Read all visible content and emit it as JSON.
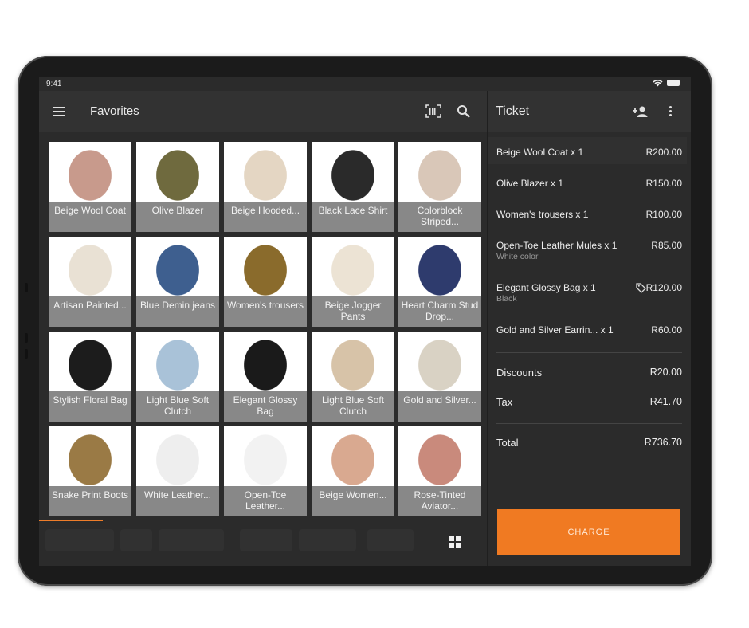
{
  "status": {
    "time": "9:41"
  },
  "header": {
    "title": "Favorites",
    "barcode_icon": "barcode-scan-icon",
    "search_icon": "search-icon",
    "menu_icon": "hamburger-menu-icon"
  },
  "products": [
    {
      "label": "Beige Wool Coat",
      "color": "#c89a8c"
    },
    {
      "label": "Olive Blazer",
      "color": "#6f6a3e"
    },
    {
      "label": "Beige Hooded...",
      "color": "#e4d6c3"
    },
    {
      "label": "Black Lace Shirt",
      "color": "#2a2a2a"
    },
    {
      "label": "Colorblock Striped...",
      "color": "#d9c7b8"
    },
    {
      "label": "Artisan Painted...",
      "color": "#e9e1d4"
    },
    {
      "label": "Blue Demin jeans",
      "color": "#3e5f8f"
    },
    {
      "label": "Women's trousers",
      "color": "#8a6b2c"
    },
    {
      "label": "Beige Jogger Pants",
      "color": "#ece3d4"
    },
    {
      "label": "Heart Charm Stud Drop...",
      "color": "#2e3b6d"
    },
    {
      "label": "Stylish Floral Bag",
      "color": "#1c1c1c"
    },
    {
      "label": "Light Blue Soft Clutch",
      "color": "#a9c2d8"
    },
    {
      "label": "Elegant Glossy Bag",
      "color": "#1a1a1a"
    },
    {
      "label": "Light Blue Soft Clutch",
      "color": "#d7c3a8"
    },
    {
      "label": "Gold and Silver...",
      "color": "#d9d2c4"
    },
    {
      "label": "Snake Print Boots",
      "color": "#9a7a45"
    },
    {
      "label": "White Leather...",
      "color": "#eeeeee"
    },
    {
      "label": "Open-Toe Leather...",
      "color": "#f2f2f2"
    },
    {
      "label": "Beige Women...",
      "color": "#d9a990"
    },
    {
      "label": "Rose-Tinted Aviator...",
      "color": "#c98a7c"
    }
  ],
  "ticket": {
    "title": "Ticket",
    "items": [
      {
        "name": "Beige Wool Coat x 1",
        "price": "R200.00",
        "sub": ""
      },
      {
        "name": "Olive Blazer x 1",
        "price": "R150.00",
        "sub": ""
      },
      {
        "name": "Women's trousers x 1",
        "price": "R100.00",
        "sub": ""
      },
      {
        "name": "Open-Toe Leather Mules x 1",
        "price": "R85.00",
        "sub": "White color"
      },
      {
        "name": "Elegant Glossy Bag x 1",
        "price": "R120.00",
        "sub": "Black"
      },
      {
        "name": "Gold and Silver Earrin... x 1",
        "price": "R60.00",
        "sub": ""
      }
    ],
    "discounts_label": "Discounts",
    "discounts_value": "R20.00",
    "tax_label": "Tax",
    "tax_value": "R41.70",
    "total_label": "Total",
    "total_value": "R736.70",
    "charge_label": "CHARGE"
  },
  "colors": {
    "accent": "#f07a22",
    "panel": "#2b2b2b",
    "header": "#323232"
  }
}
